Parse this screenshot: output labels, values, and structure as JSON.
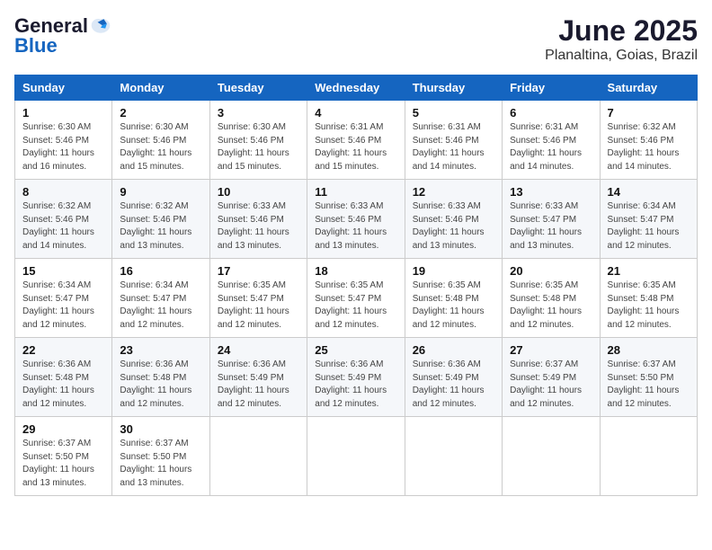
{
  "logo": {
    "general": "General",
    "blue": "Blue"
  },
  "title": "June 2025",
  "subtitle": "Planaltina, Goias, Brazil",
  "days_of_week": [
    "Sunday",
    "Monday",
    "Tuesday",
    "Wednesday",
    "Thursday",
    "Friday",
    "Saturday"
  ],
  "weeks": [
    [
      {
        "day": "1",
        "sunrise": "6:30 AM",
        "sunset": "5:46 PM",
        "daylight": "11 hours and 16 minutes."
      },
      {
        "day": "2",
        "sunrise": "6:30 AM",
        "sunset": "5:46 PM",
        "daylight": "11 hours and 15 minutes."
      },
      {
        "day": "3",
        "sunrise": "6:30 AM",
        "sunset": "5:46 PM",
        "daylight": "11 hours and 15 minutes."
      },
      {
        "day": "4",
        "sunrise": "6:31 AM",
        "sunset": "5:46 PM",
        "daylight": "11 hours and 15 minutes."
      },
      {
        "day": "5",
        "sunrise": "6:31 AM",
        "sunset": "5:46 PM",
        "daylight": "11 hours and 14 minutes."
      },
      {
        "day": "6",
        "sunrise": "6:31 AM",
        "sunset": "5:46 PM",
        "daylight": "11 hours and 14 minutes."
      },
      {
        "day": "7",
        "sunrise": "6:32 AM",
        "sunset": "5:46 PM",
        "daylight": "11 hours and 14 minutes."
      }
    ],
    [
      {
        "day": "8",
        "sunrise": "6:32 AM",
        "sunset": "5:46 PM",
        "daylight": "11 hours and 14 minutes."
      },
      {
        "day": "9",
        "sunrise": "6:32 AM",
        "sunset": "5:46 PM",
        "daylight": "11 hours and 13 minutes."
      },
      {
        "day": "10",
        "sunrise": "6:33 AM",
        "sunset": "5:46 PM",
        "daylight": "11 hours and 13 minutes."
      },
      {
        "day": "11",
        "sunrise": "6:33 AM",
        "sunset": "5:46 PM",
        "daylight": "11 hours and 13 minutes."
      },
      {
        "day": "12",
        "sunrise": "6:33 AM",
        "sunset": "5:46 PM",
        "daylight": "11 hours and 13 minutes."
      },
      {
        "day": "13",
        "sunrise": "6:33 AM",
        "sunset": "5:47 PM",
        "daylight": "11 hours and 13 minutes."
      },
      {
        "day": "14",
        "sunrise": "6:34 AM",
        "sunset": "5:47 PM",
        "daylight": "11 hours and 12 minutes."
      }
    ],
    [
      {
        "day": "15",
        "sunrise": "6:34 AM",
        "sunset": "5:47 PM",
        "daylight": "11 hours and 12 minutes."
      },
      {
        "day": "16",
        "sunrise": "6:34 AM",
        "sunset": "5:47 PM",
        "daylight": "11 hours and 12 minutes."
      },
      {
        "day": "17",
        "sunrise": "6:35 AM",
        "sunset": "5:47 PM",
        "daylight": "11 hours and 12 minutes."
      },
      {
        "day": "18",
        "sunrise": "6:35 AM",
        "sunset": "5:47 PM",
        "daylight": "11 hours and 12 minutes."
      },
      {
        "day": "19",
        "sunrise": "6:35 AM",
        "sunset": "5:48 PM",
        "daylight": "11 hours and 12 minutes."
      },
      {
        "day": "20",
        "sunrise": "6:35 AM",
        "sunset": "5:48 PM",
        "daylight": "11 hours and 12 minutes."
      },
      {
        "day": "21",
        "sunrise": "6:35 AM",
        "sunset": "5:48 PM",
        "daylight": "11 hours and 12 minutes."
      }
    ],
    [
      {
        "day": "22",
        "sunrise": "6:36 AM",
        "sunset": "5:48 PM",
        "daylight": "11 hours and 12 minutes."
      },
      {
        "day": "23",
        "sunrise": "6:36 AM",
        "sunset": "5:48 PM",
        "daylight": "11 hours and 12 minutes."
      },
      {
        "day": "24",
        "sunrise": "6:36 AM",
        "sunset": "5:49 PM",
        "daylight": "11 hours and 12 minutes."
      },
      {
        "day": "25",
        "sunrise": "6:36 AM",
        "sunset": "5:49 PM",
        "daylight": "11 hours and 12 minutes."
      },
      {
        "day": "26",
        "sunrise": "6:36 AM",
        "sunset": "5:49 PM",
        "daylight": "11 hours and 12 minutes."
      },
      {
        "day": "27",
        "sunrise": "6:37 AM",
        "sunset": "5:49 PM",
        "daylight": "11 hours and 12 minutes."
      },
      {
        "day": "28",
        "sunrise": "6:37 AM",
        "sunset": "5:50 PM",
        "daylight": "11 hours and 12 minutes."
      }
    ],
    [
      {
        "day": "29",
        "sunrise": "6:37 AM",
        "sunset": "5:50 PM",
        "daylight": "11 hours and 13 minutes."
      },
      {
        "day": "30",
        "sunrise": "6:37 AM",
        "sunset": "5:50 PM",
        "daylight": "11 hours and 13 minutes."
      },
      null,
      null,
      null,
      null,
      null
    ]
  ]
}
